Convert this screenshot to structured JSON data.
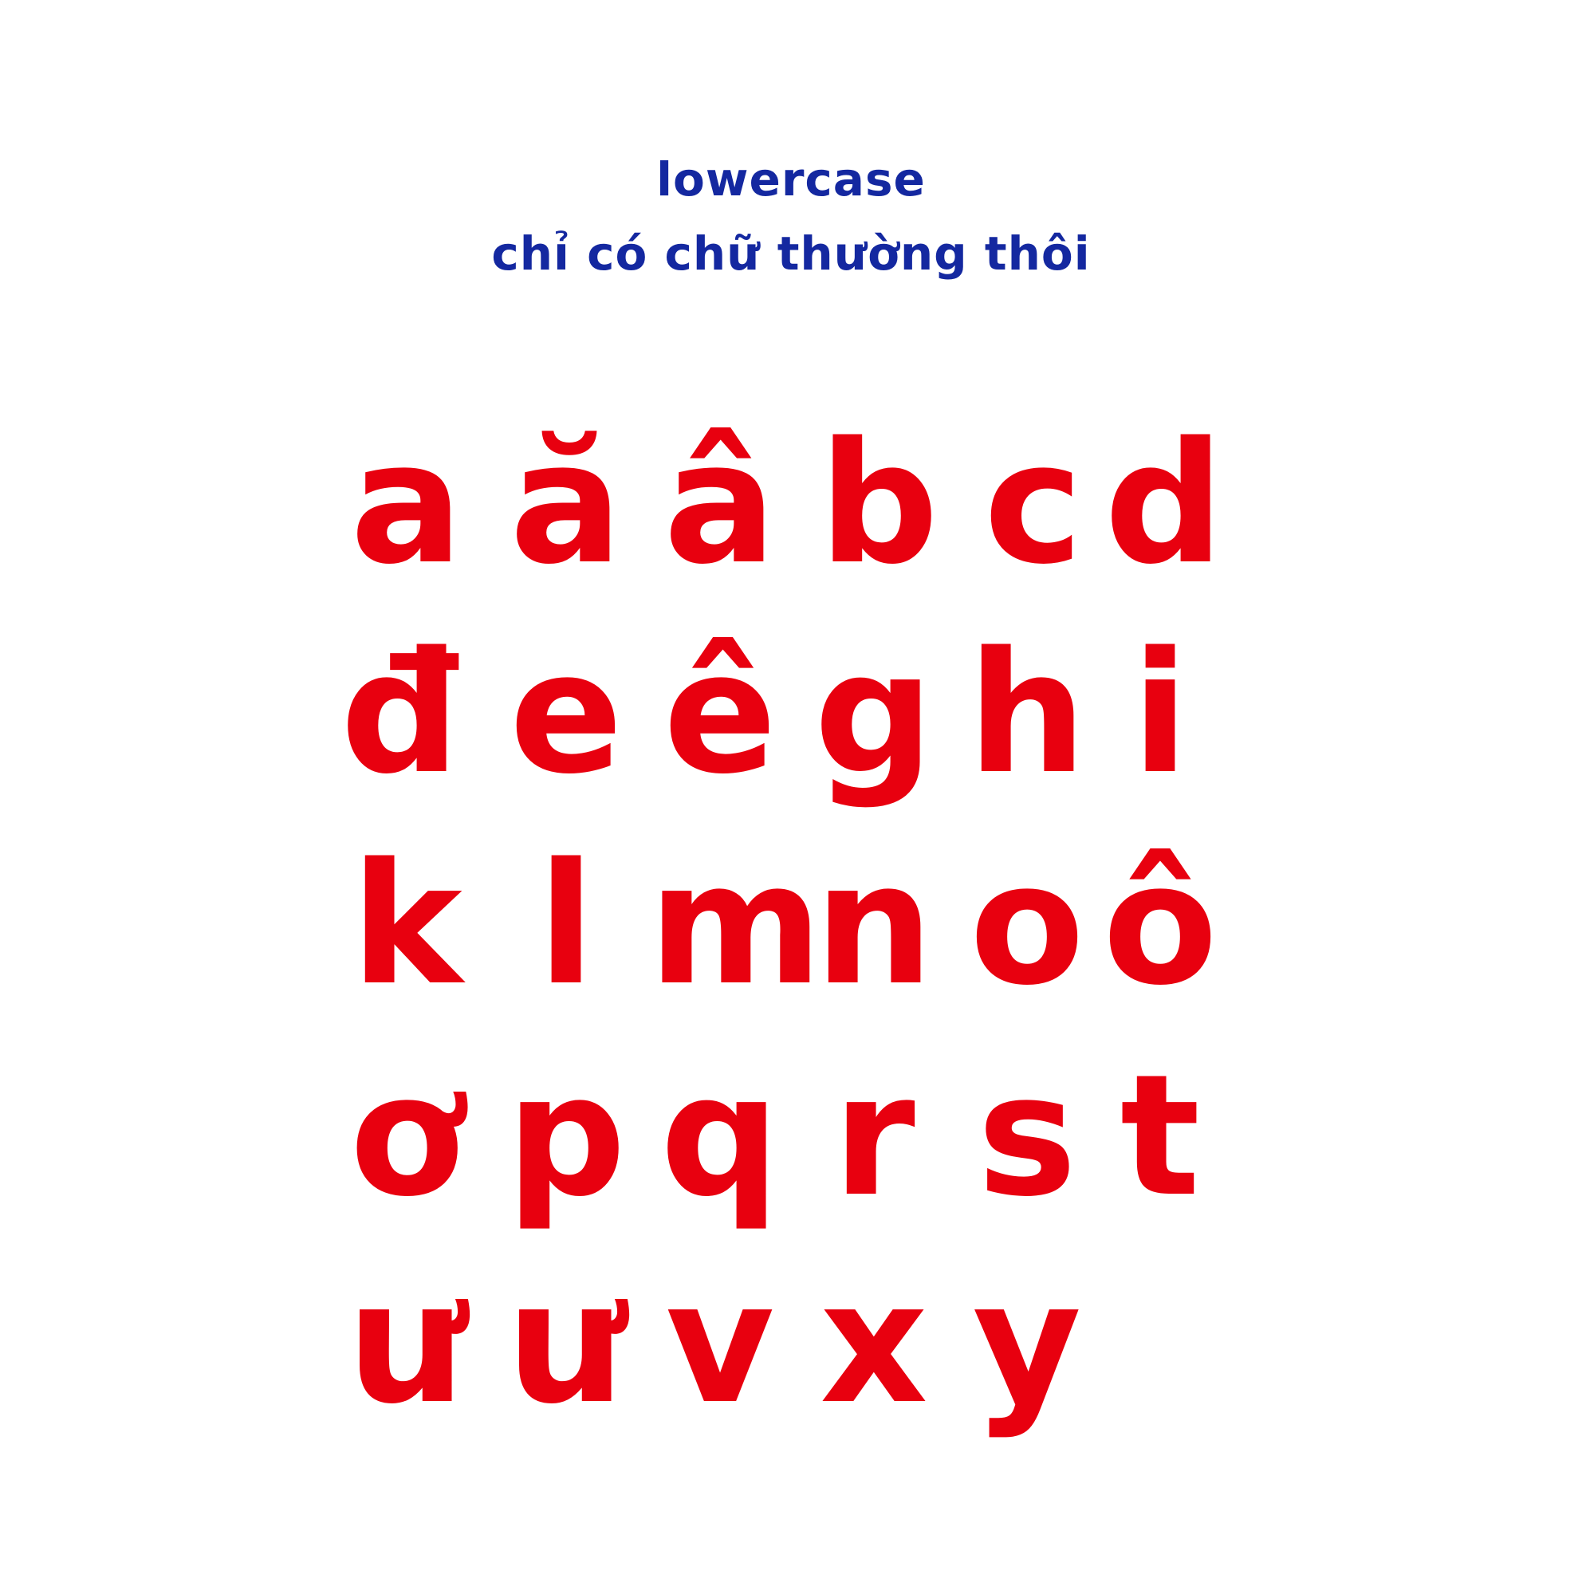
{
  "header": {
    "title": "lowercase",
    "subtitle": "chỉ có chữ thường thôi"
  },
  "colors": {
    "title_color": "#1428a0",
    "letter_color": "#e8000f",
    "background": "#ffffff"
  },
  "alphabet": {
    "rows": [
      [
        "a",
        "ă",
        "â",
        "b",
        "c",
        "d"
      ],
      [
        "đ",
        "e",
        "ê",
        "g",
        "h",
        "i"
      ],
      [
        "k",
        "l",
        "m",
        "n",
        "o",
        "ô"
      ],
      [
        "ơ",
        "p",
        "q",
        "r",
        "s",
        "t"
      ],
      [
        "ư",
        "ư",
        "v",
        "x",
        "y"
      ]
    ]
  }
}
